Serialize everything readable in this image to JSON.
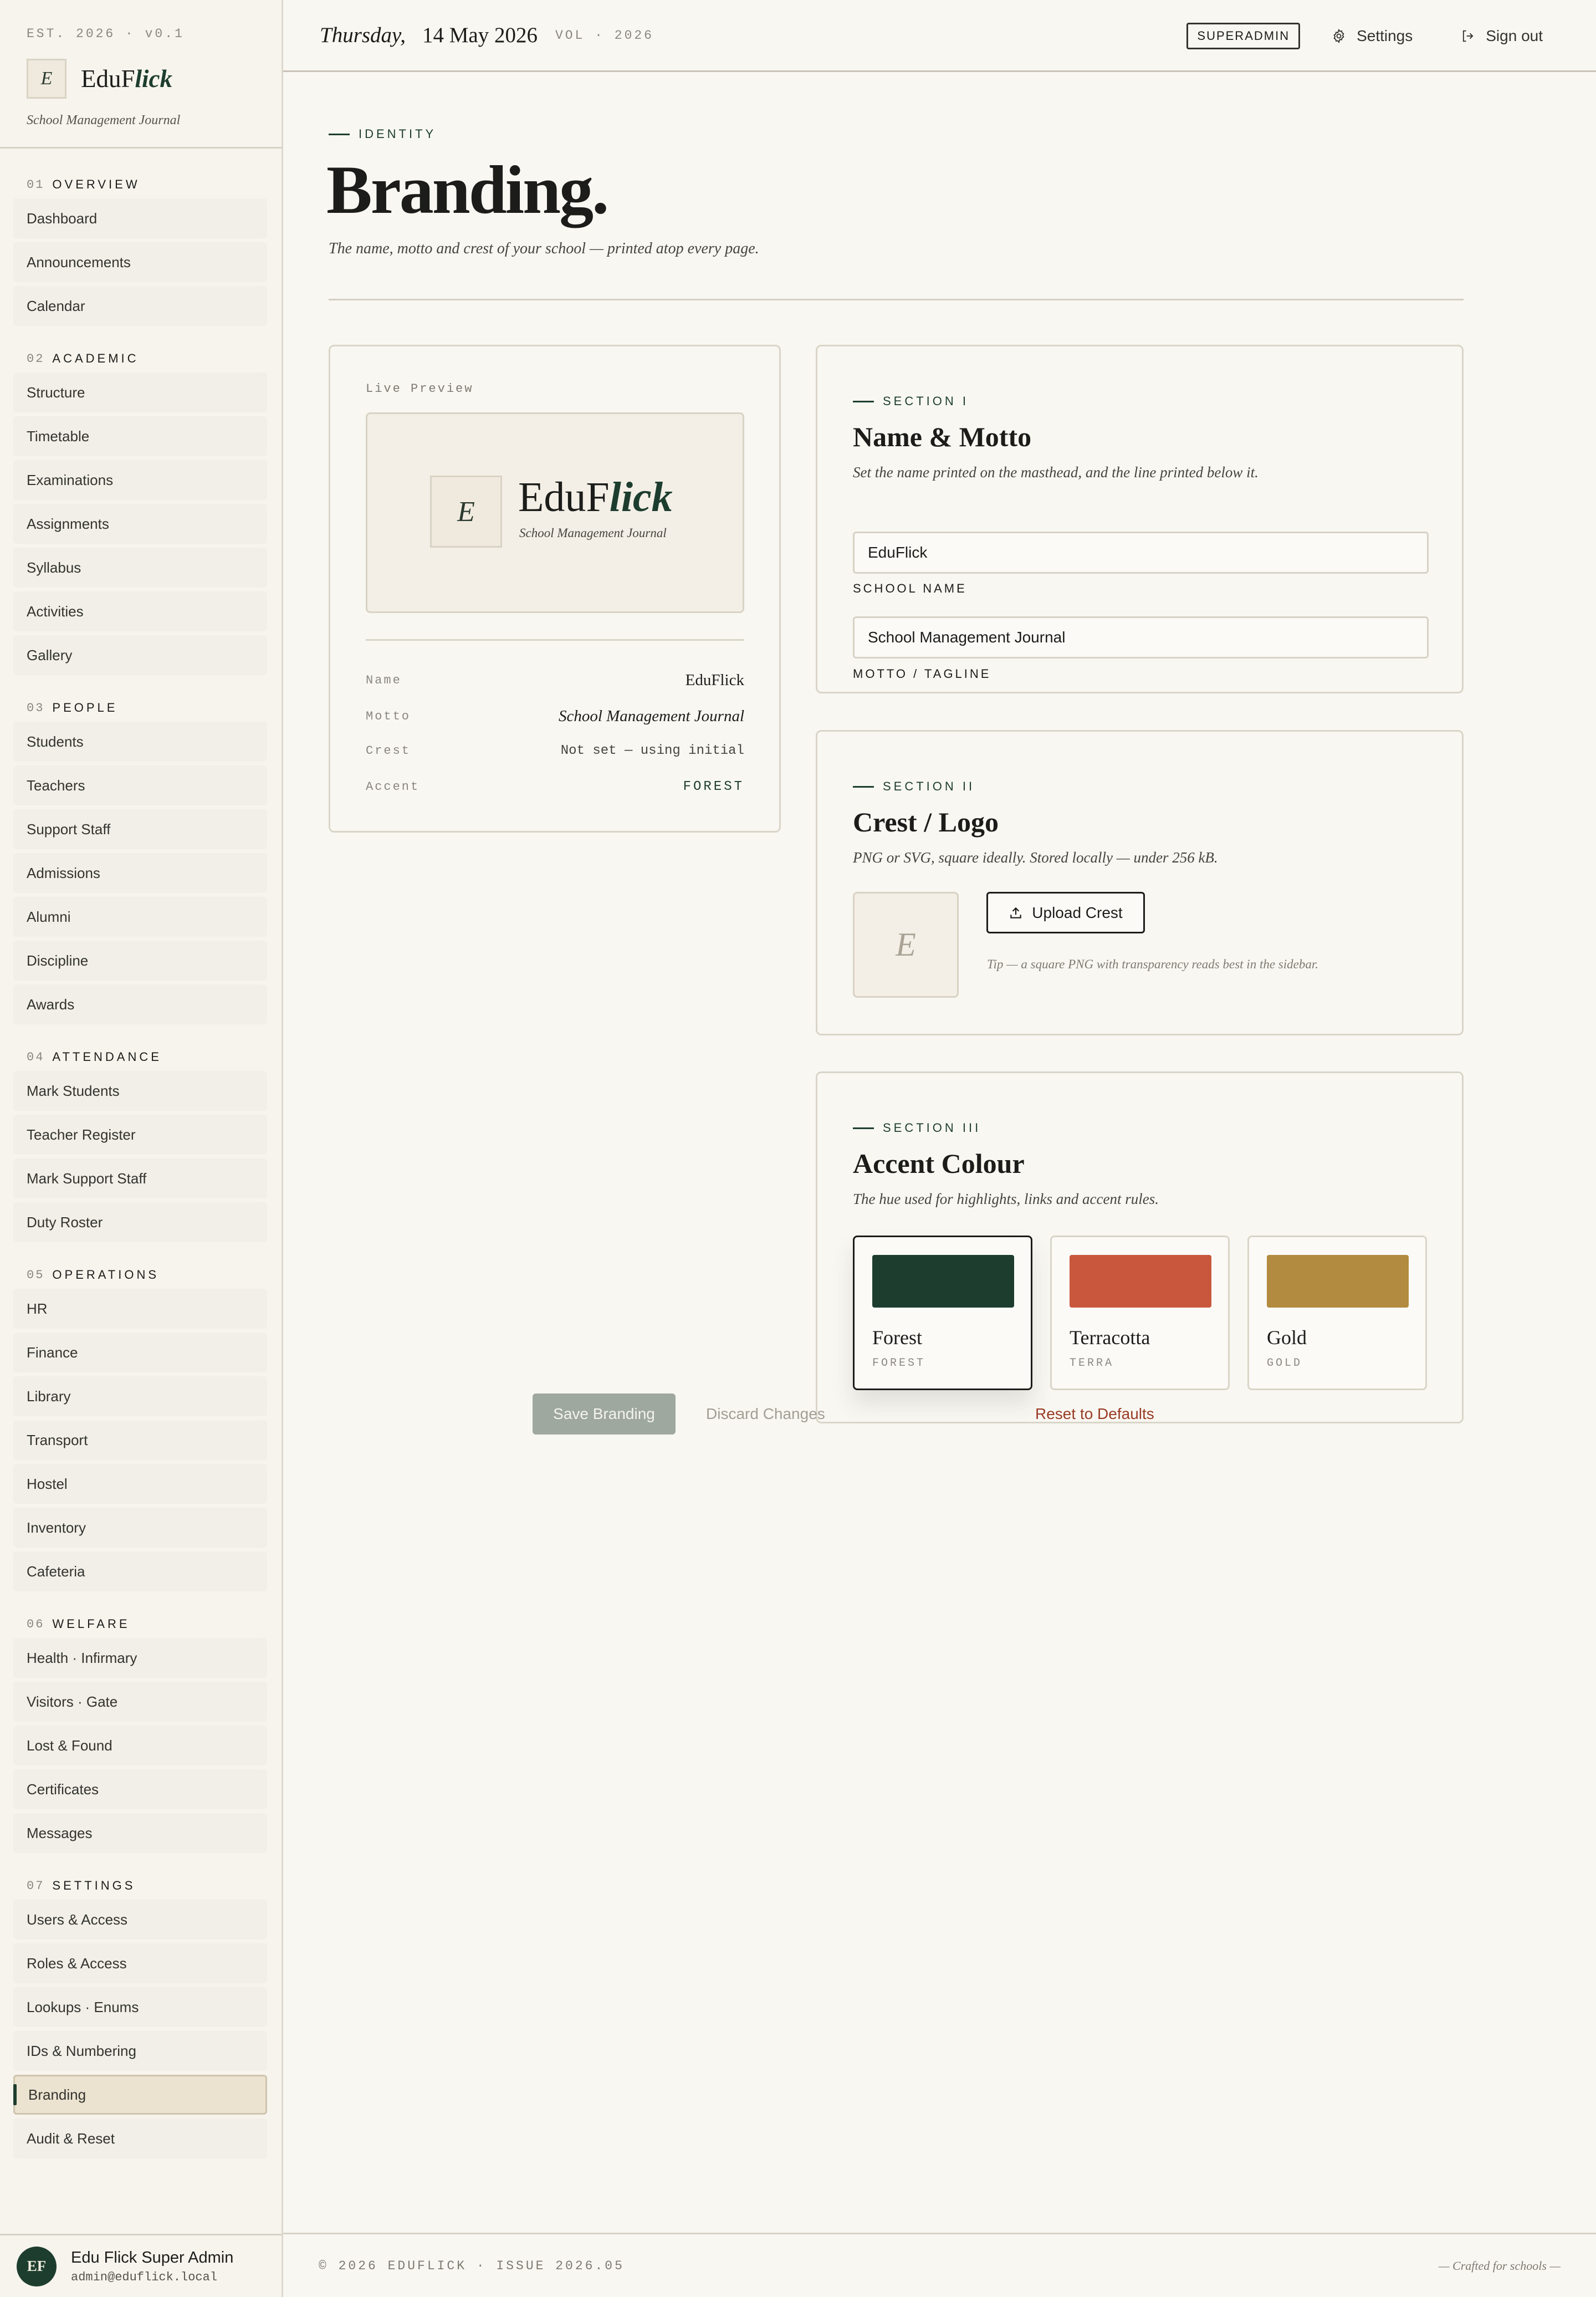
{
  "sidebar": {
    "est": "EST. 2026 · v0.1",
    "logo_initial": "E",
    "brand_main": "EduF",
    "brand_accent": "lick",
    "tagline": "School Management Journal",
    "groups": [
      {
        "num": "01",
        "title": "OVERVIEW",
        "items": [
          "Dashboard",
          "Announcements",
          "Calendar"
        ]
      },
      {
        "num": "02",
        "title": "ACADEMIC",
        "items": [
          "Structure",
          "Timetable",
          "Examinations",
          "Assignments",
          "Syllabus",
          "Activities",
          "Gallery"
        ]
      },
      {
        "num": "03",
        "title": "PEOPLE",
        "items": [
          "Students",
          "Teachers",
          "Support Staff",
          "Admissions",
          "Alumni",
          "Discipline",
          "Awards"
        ]
      },
      {
        "num": "04",
        "title": "ATTENDANCE",
        "items": [
          "Mark Students",
          "Teacher Register",
          "Mark Support Staff",
          "Duty Roster"
        ]
      },
      {
        "num": "05",
        "title": "OPERATIONS",
        "items": [
          "HR",
          "Finance",
          "Library",
          "Transport",
          "Hostel",
          "Inventory",
          "Cafeteria"
        ]
      },
      {
        "num": "06",
        "title": "WELFARE",
        "items": [
          "Health · Infirmary",
          "Visitors · Gate",
          "Lost & Found",
          "Certificates",
          "Messages"
        ]
      },
      {
        "num": "07",
        "title": "SETTINGS",
        "items": [
          "Users & Access",
          "Roles & Access",
          "Lookups · Enums",
          "IDs & Numbering",
          "Branding",
          "Audit & Reset"
        ]
      }
    ],
    "active_item": "Branding",
    "user": {
      "initials": "EF",
      "name": "Edu Flick Super Admin",
      "email": "admin@eduflick.local"
    }
  },
  "topbar": {
    "day": "Thursday,",
    "date": "14 May 2026",
    "vol": "VOL · 2026",
    "role_badge": "SUPERADMIN",
    "settings_label": "Settings",
    "signout_label": "Sign out"
  },
  "page": {
    "eyebrow": "IDENTITY",
    "title": "Branding.",
    "subtitle": "The name, motto and crest of your school — printed atop every page."
  },
  "preview": {
    "label": "Live Preview",
    "logo_initial": "E",
    "name_main": "EduF",
    "name_accent": "lick",
    "tagline": "School Management Journal",
    "rows": [
      {
        "key": "Name",
        "value": "EduFlick"
      },
      {
        "key": "Motto",
        "value": "School Management Journal"
      },
      {
        "key": "Crest",
        "value": "Not set — using initial"
      },
      {
        "key": "Accent",
        "value": "FOREST"
      }
    ]
  },
  "section1": {
    "eyebrow": "SECTION I",
    "title": "Name & Motto",
    "subtitle": "Set the name printed on the masthead, and the line printed below it.",
    "school_name_label": "SCHOOL NAME",
    "school_name_value": "EduFlick",
    "motto_label": "MOTTO / TAGLINE",
    "motto_value": "School Management Journal"
  },
  "section2": {
    "eyebrow": "SECTION II",
    "title": "Crest / Logo",
    "subtitle": "PNG or SVG, square ideally. Stored locally — under 256 kB.",
    "placeholder_initial": "E",
    "upload_label": "Upload Crest",
    "tip": "Tip — a square PNG with transparency reads best in the sidebar."
  },
  "section3": {
    "eyebrow": "SECTION III",
    "title": "Accent Colour",
    "subtitle": "The hue used for highlights, links and accent rules.",
    "swatches": [
      {
        "name": "Forest",
        "code": "FOREST",
        "color": "#1d3d2e",
        "selected": true
      },
      {
        "name": "Terracotta",
        "code": "TERRA",
        "color": "#c9573d",
        "selected": false
      },
      {
        "name": "Gold",
        "code": "GOLD",
        "color": "#b38b40",
        "selected": false
      }
    ]
  },
  "actions": {
    "save": "Save Branding",
    "discard": "Discard Changes",
    "reset": "Reset to Defaults"
  },
  "footer": {
    "left": "© 2026 EDUFLICK · ISSUE 2026.05",
    "right": "— Crafted for schools —"
  },
  "colors": {
    "accent": "#1d3d2e",
    "background": "#f9f7f2",
    "danger": "#9a3b26"
  }
}
